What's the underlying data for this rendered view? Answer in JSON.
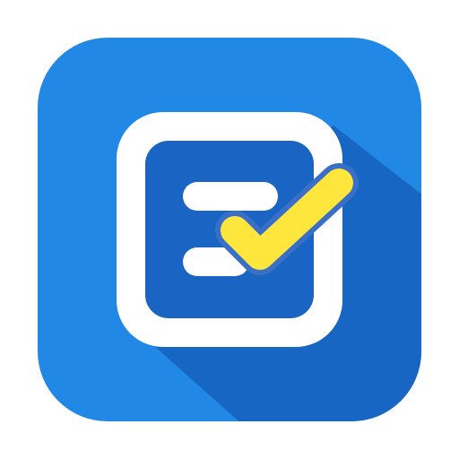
{
  "icon": {
    "name": "checklist-app-icon",
    "colors": {
      "background": "#2188e6",
      "shadow": "#1766c4",
      "frame": "#ffffff",
      "panel": "#1a64c4",
      "lines": "#ffffff",
      "checkmark": "#ffe63d",
      "checkmark_outline": "#3a6fc8"
    }
  }
}
